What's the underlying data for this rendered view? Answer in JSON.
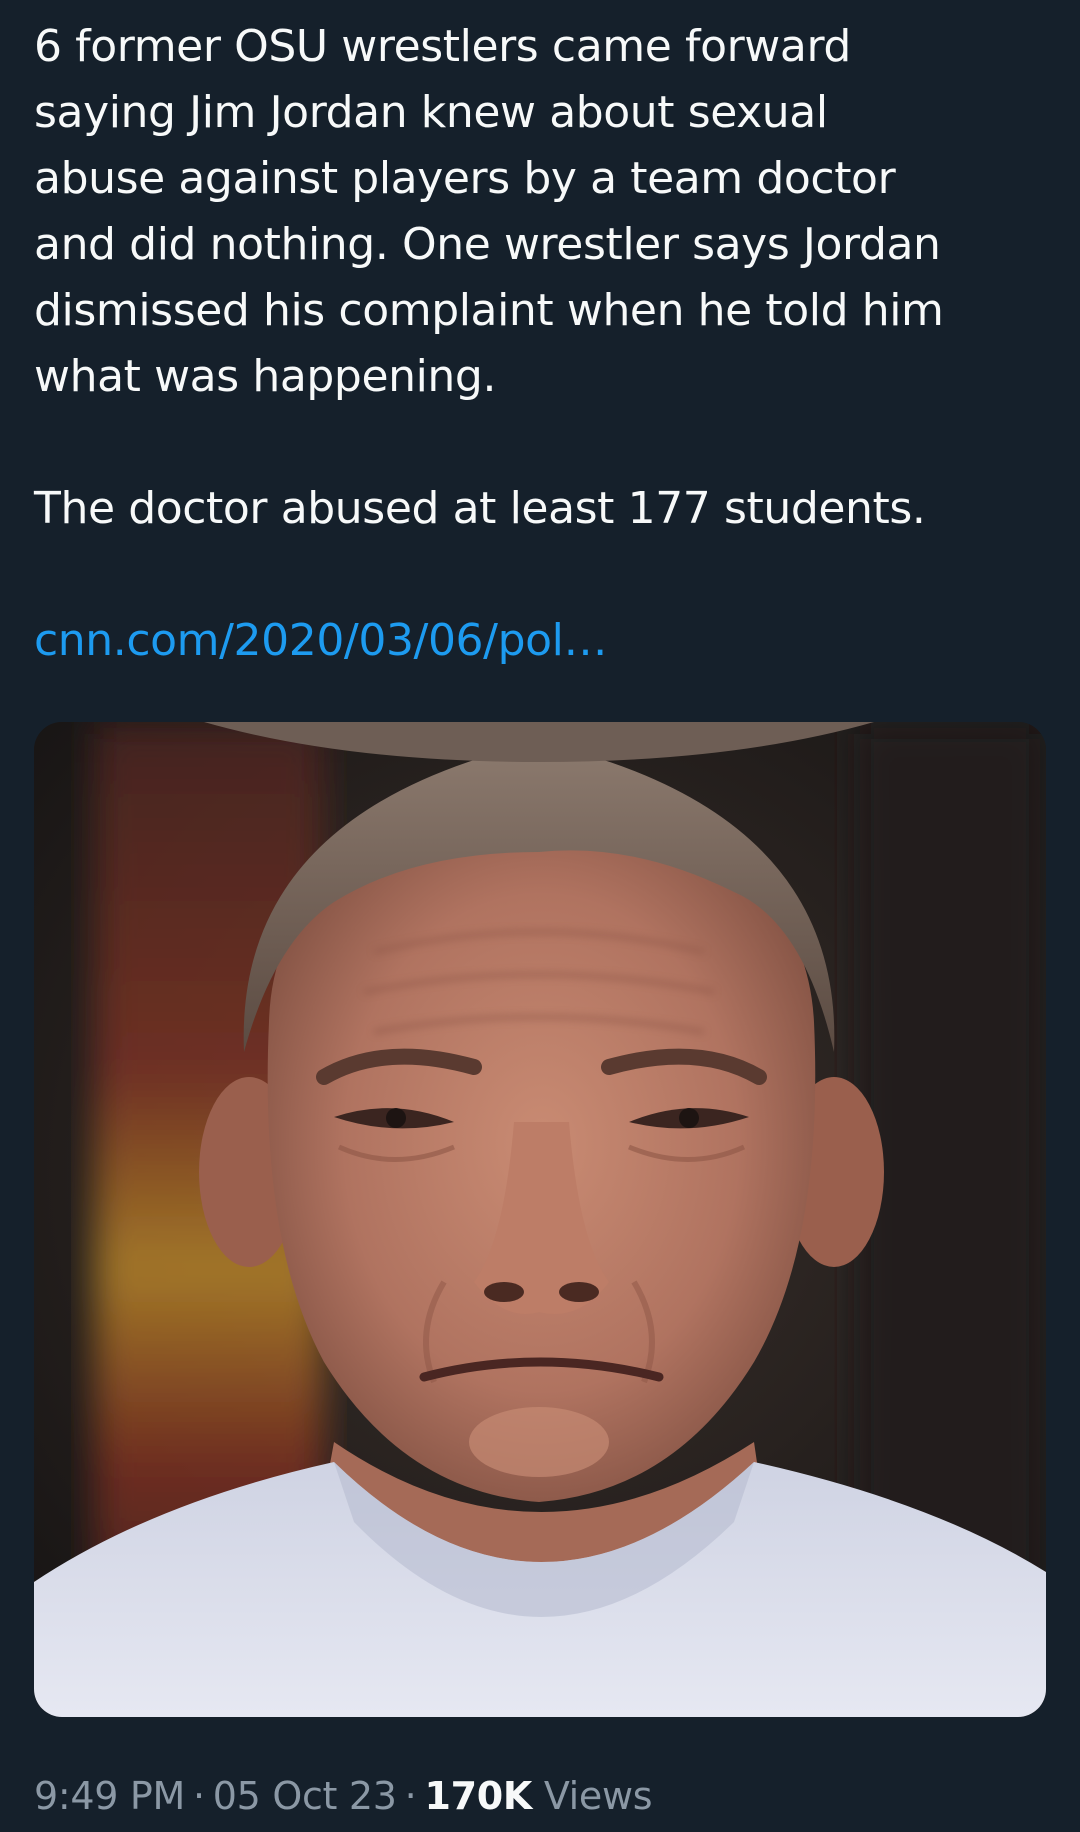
{
  "tweet": {
    "paragraph_1": "6 former OSU wrestlers came forward\nsaying Jim Jordan knew about sexual\nabuse against players by a team doctor\nand did nothing. One wrestler says Jordan\ndismissed his complaint when he told him\nwhat was happening.",
    "paragraph_2": "The doctor abused at least 177 students.",
    "link_text": "cnn.com/2020/03/06/pol…",
    "time": "9:49 PM",
    "separator": "·",
    "date": "05 Oct 23",
    "views_count": "170K",
    "views_label": "Views"
  },
  "colors": {
    "background": "#15202b",
    "text": "#f7f9f9",
    "link": "#1d9bf0",
    "meta": "#8b98a5"
  }
}
